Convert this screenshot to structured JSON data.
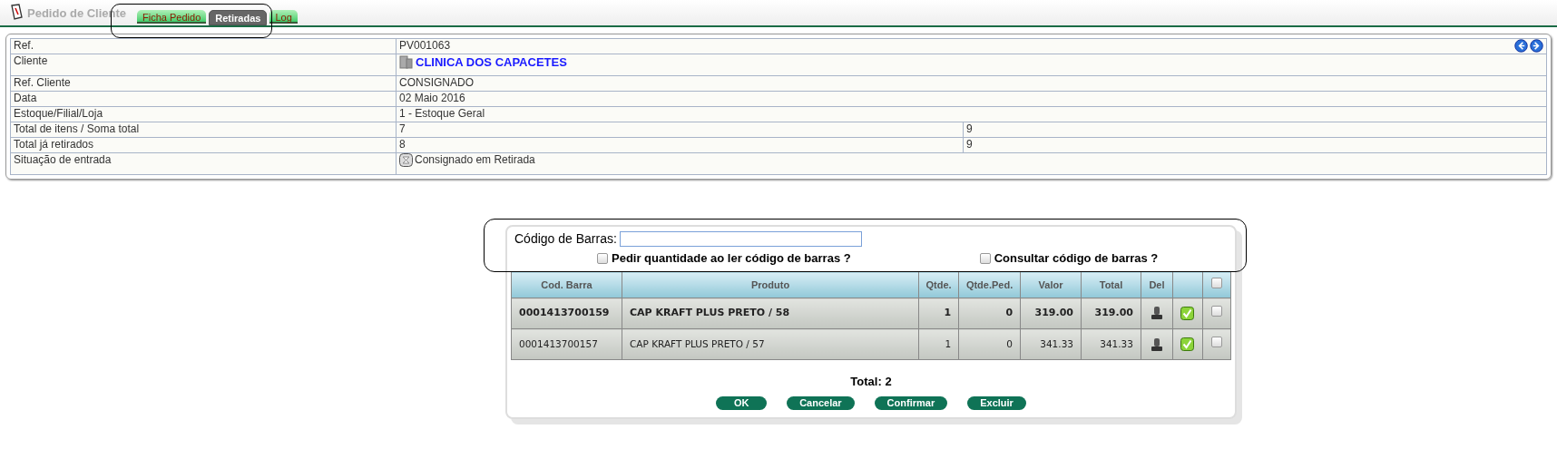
{
  "header": {
    "title": "Pedido de Cliente"
  },
  "tabs": [
    {
      "label": "Ficha Pedido",
      "selected": false
    },
    {
      "label": "Retiradas",
      "selected": true
    },
    {
      "label": "Log",
      "selected": false
    }
  ],
  "info": [
    {
      "label": "Ref.",
      "value": "PV001063",
      "nav": true
    },
    {
      "label": "Cliente",
      "value": "CLINICA DOS CAPACETES",
      "kind": "link"
    },
    {
      "label": "Ref. Cliente",
      "value": "CONSIGNADO"
    },
    {
      "label": "Data",
      "value": "02 Maio 2016"
    },
    {
      "label": "Estoque/Filial/Loja",
      "value": "1 - Estoque Geral"
    },
    {
      "label": "Total de itens / Soma total",
      "value": "7",
      "value_2": "9"
    },
    {
      "label": "Total já retirados",
      "value": "8",
      "value_2": "9"
    },
    {
      "label": "Situação de entrada",
      "value": "Consignado em Retirada",
      "kind": "status"
    }
  ],
  "barcode": {
    "label": "Código de Barras:"
  },
  "options": [
    {
      "label": "Pedir quantidade ao ler código de barras ?",
      "checked": false
    },
    {
      "label": "Consultar código de barras ?",
      "checked": false
    }
  ],
  "table": {
    "columns": [
      "Cod. Barra",
      "Produto",
      "Qtde.",
      "Qtde.Ped.",
      "Valor",
      "Total",
      "Del"
    ],
    "select_all": false,
    "rows": [
      {
        "barcode": "0001413700159",
        "product": "CAP KRAFT PLUS PRETO / 58",
        "qty": "1",
        "qty_ordered": "0",
        "value": "319.00",
        "total": "319.00",
        "bold": true,
        "checked": false
      },
      {
        "barcode": "0001413700157",
        "product": "CAP KRAFT PLUS PRETO / 57",
        "qty": "1",
        "qty_ordered": "0",
        "value": "341.33",
        "total": "341.33",
        "bold": false,
        "checked": false
      }
    ]
  },
  "total": "Total: 2",
  "buttons": [
    "OK",
    "Cancelar",
    "Confirmar",
    "Excluir"
  ]
}
